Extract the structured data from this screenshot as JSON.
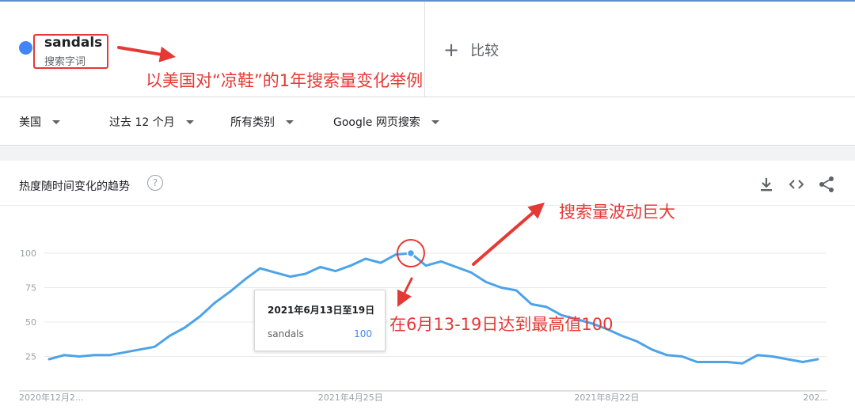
{
  "search_term": {
    "name": "sandals",
    "type": "搜索字词",
    "color": "#4285f4"
  },
  "compare": {
    "plus": "+",
    "label": "比较"
  },
  "filters": [
    {
      "label": "美国"
    },
    {
      "label": "过去 12 个月"
    },
    {
      "label": "所有类别"
    },
    {
      "label": "Google 网页搜索"
    }
  ],
  "card": {
    "title": "热度随时间变化的趋势",
    "help": "?"
  },
  "annotations": {
    "example": "以美国对“凉鞋”的1年搜索量变化举例",
    "fluctuation": "搜索量波动巨大",
    "peak": "在6月13-19日达到最高值100",
    "color": "#e53935"
  },
  "tooltip": {
    "date": "2021年6月13日至19日",
    "series": "sandals",
    "value": "100"
  },
  "chart_data": {
    "type": "line",
    "ylim": [
      0,
      100
    ],
    "yticks": [
      "100",
      "75",
      "50",
      "25"
    ],
    "ytick_values": [
      100,
      75,
      50,
      25
    ],
    "xtick_labels": [
      "2020年12月2...",
      "2021年4月25日",
      "2021年8月22日",
      "202..."
    ],
    "xtick_indices": [
      0,
      20,
      37,
      52
    ],
    "grid": true,
    "series": [
      {
        "line_color": "#4da3e8",
        "values": [
          23,
          26,
          25,
          26,
          26,
          28,
          30,
          32,
          40,
          46,
          54,
          64,
          72,
          81,
          89,
          86,
          83,
          85,
          90,
          87,
          91,
          96,
          93,
          99,
          100,
          91,
          94,
          90,
          86,
          79,
          75,
          73,
          63,
          61,
          55,
          52,
          49,
          45,
          40,
          36,
          30,
          26,
          25,
          21,
          21,
          21,
          20,
          26,
          25,
          23,
          21,
          23
        ]
      }
    ],
    "peak_index": 24
  }
}
